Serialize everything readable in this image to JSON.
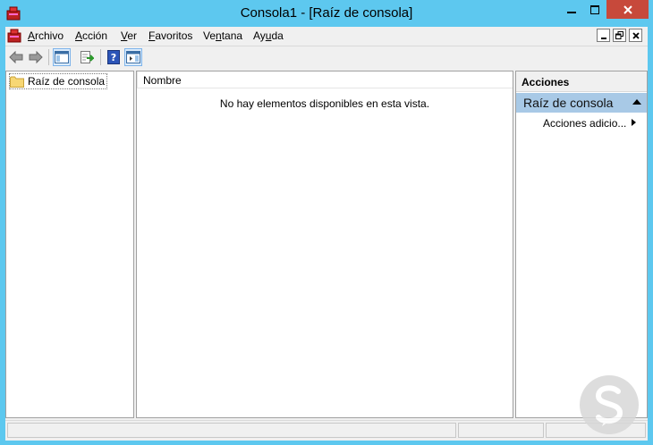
{
  "window": {
    "title": "Consola1 - [Raíz de consola]"
  },
  "menu": {
    "items": [
      {
        "label": "Archivo",
        "accel": "A",
        "rest": "rchivo"
      },
      {
        "label": "Acción",
        "accel": "A",
        "rest": "cción"
      },
      {
        "label": "Ver",
        "accel": "V",
        "rest": "er"
      },
      {
        "label": "Favoritos",
        "accel": "F",
        "rest": "avoritos"
      },
      {
        "label": "Ventana",
        "pre": "Ve",
        "accel": "n",
        "rest": "tana"
      },
      {
        "label": "Ayuda",
        "pre": "Ay",
        "accel": "u",
        "rest": "da"
      }
    ]
  },
  "tree": {
    "root_label": "Raíz de consola"
  },
  "list": {
    "column_name": "Nombre",
    "empty_message": "No hay elementos disponibles en esta vista."
  },
  "actions": {
    "title": "Acciones",
    "section": "Raíz de consola",
    "item": "Acciones adicio..."
  },
  "colors": {
    "frame": "#5dc8ef",
    "close_button": "#c7493b",
    "actions_section": "#a8c9e6"
  }
}
